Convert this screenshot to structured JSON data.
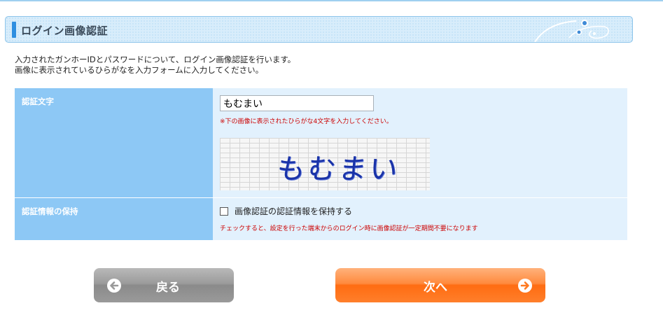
{
  "header": {
    "title": "ログイン画像認証"
  },
  "description": {
    "line1": "入力されたガンホーIDとパスワードについて、ログイン画像認証を行います。",
    "line2": "画像に表示されているひらがなを入力フォームに入力してください。"
  },
  "captcha": {
    "label": "認証文字",
    "input_value": "もむまい",
    "note": "※下の画像に表示されたひらがな4文字を入力してください。",
    "image_text": "もむまい"
  },
  "remember": {
    "label": "認証情報の保持",
    "checkbox_label": "画像認証の認証情報を保持する",
    "checked": false,
    "note": "チェックすると、設定を行った端末からのログイン時に画像認証が一定期間不要になります"
  },
  "buttons": {
    "back_label": "戻る",
    "next_label": "次へ"
  },
  "colors": {
    "accent": "#2f8fe0",
    "label_bg": "#8dc8f5",
    "value_bg": "#e2f1fd",
    "note": "#cc0000",
    "next_button": "#ff7f2b",
    "back_button": "#9b9b9b"
  },
  "icons": {
    "back": "arrow-left-circle-icon",
    "next": "arrow-right-circle-icon"
  }
}
